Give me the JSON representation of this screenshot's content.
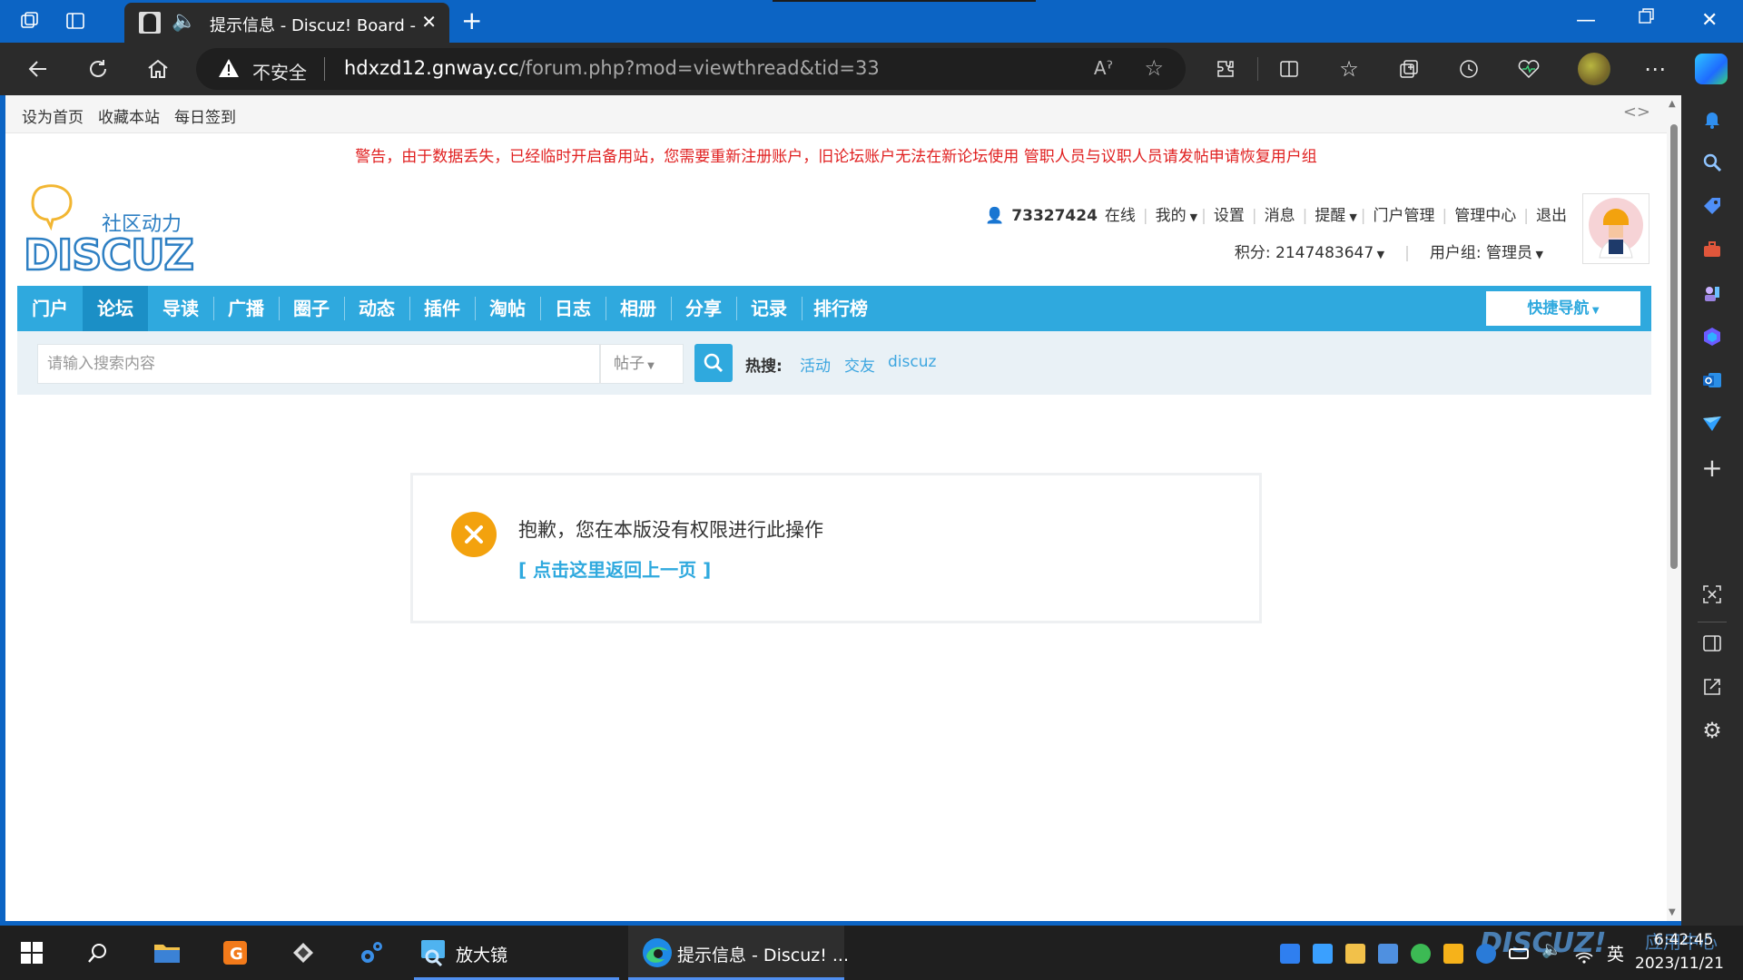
{
  "browser": {
    "tab_title": "提示信息 - Discuz! Board - P",
    "new_tab": "+",
    "security_label": "不安全",
    "url_host": "hdxzd12.gnway.cc",
    "url_path": "/forum.php?mod=viewthread&tid=33",
    "read_aloud": "Aˀ"
  },
  "page": {
    "topbar": {
      "links": [
        "设为首页",
        "收藏本站",
        "每日签到"
      ],
      "toggle": "<>"
    },
    "warning": "警告，由于数据丢失，已经临时开启备用站，您需要重新注册账户，旧论坛账户无法在新论坛使用 管职人员与议职人员请发帖申请恢复用户组",
    "logo": {
      "tagline": "社区动力",
      "brand": "DISCUZ!"
    },
    "user": {
      "uid": "73327424",
      "online": "在线",
      "menu": [
        "我的",
        "设置",
        "消息",
        "提醒",
        "门户管理",
        "管理中心",
        "退出"
      ],
      "points_label": "积分: 2147483647",
      "group_label": "用户组: 管理员"
    },
    "nav": {
      "items": [
        "门户",
        "论坛",
        "导读",
        "广播",
        "圈子",
        "动态",
        "插件",
        "淘帖",
        "日志",
        "相册",
        "分享",
        "记录",
        "排行榜"
      ],
      "active": "论坛",
      "quick_nav": "快捷导航"
    },
    "search": {
      "placeholder": "请输入搜索内容",
      "type": "帖子",
      "hot_label": "热搜:",
      "hot_links": [
        "活动",
        "交友",
        "discuz"
      ]
    },
    "message": {
      "text": "抱歉，您在本版没有权限进行此操作",
      "back_link": "[ 点击这里返回上一页 ]"
    }
  },
  "taskbar": {
    "apps": [
      {
        "label": "放大镜"
      },
      {
        "label": "提示信息 - Discuz! ..."
      }
    ],
    "lang": "英",
    "time": "6:42:45",
    "date": "2023/11/21",
    "watermark_brand": "DISCUZ!",
    "watermark_cn": "应用中心"
  },
  "colors": {
    "nav_blue": "#2fa9de",
    "nav_active": "#1b8fc6",
    "warning_red": "#e02020",
    "error_orange": "#f3a20e",
    "edge_blue": "#0c64c4"
  },
  "icons": {
    "back": "arrow-left",
    "refresh": "refresh",
    "home": "home",
    "search": "magnifier",
    "error": "x-circle"
  }
}
